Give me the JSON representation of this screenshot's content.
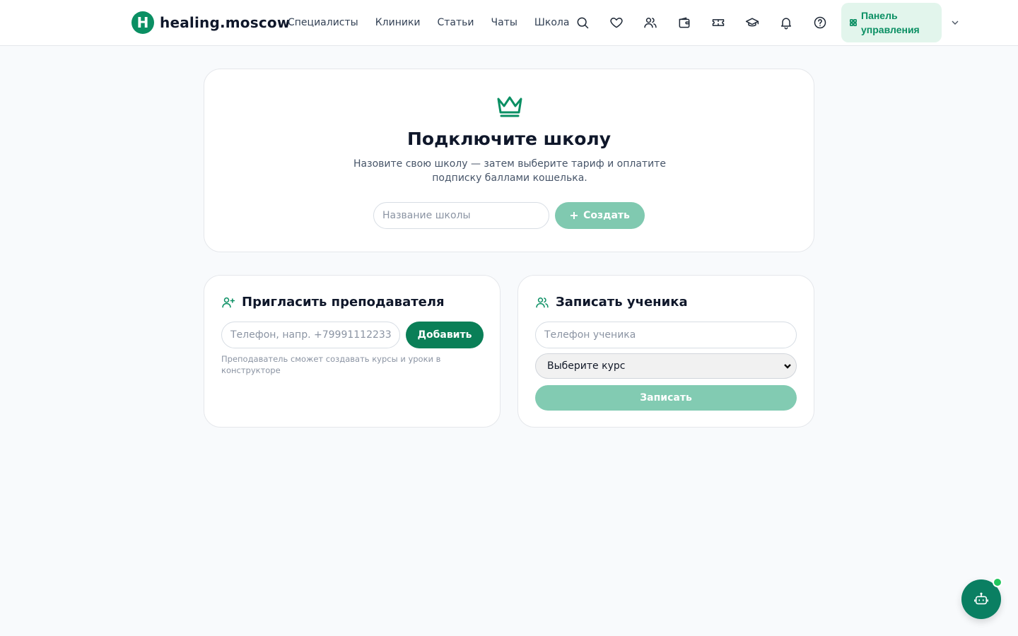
{
  "header": {
    "logo_letter": "H",
    "logo_text": "healing.moscow",
    "nav": [
      "Специалисты",
      "Клиники",
      "Статьи",
      "Чаты",
      "Школа"
    ],
    "icons": [
      "search-icon",
      "heart-icon",
      "users-icon",
      "wallet-icon",
      "ticket-icon",
      "graduation-cap-icon",
      "bell-icon",
      "help-icon"
    ],
    "panel_label": "Панель управления"
  },
  "hero": {
    "title": "Подключите школу",
    "description": "Назовите свою школу — затем выберите тариф и оплатите подписку баллами кошелька.",
    "input_placeholder": "Название школы",
    "input_value": "",
    "create_label": "Создать"
  },
  "teacher": {
    "title": "Пригласить преподавателя",
    "phone_placeholder": "Телефон, напр. +79991112233",
    "phone_value": "",
    "add_label": "Добавить",
    "hint": "Преподаватель сможет создавать курсы и уроки в конструкторе"
  },
  "student": {
    "title": "Записать ученика",
    "phone_placeholder": "Телефон ученика",
    "phone_value": "",
    "course_selected": "Выберите курс",
    "enroll_label": "Записать"
  },
  "colors": {
    "brand": "#0a8f63",
    "brand_dark": "#0a7f57",
    "brand_light": "#e2f5ec",
    "disabled_button": "#80c9b0",
    "online_dot": "#22c55e",
    "background": "#f8fafc"
  }
}
